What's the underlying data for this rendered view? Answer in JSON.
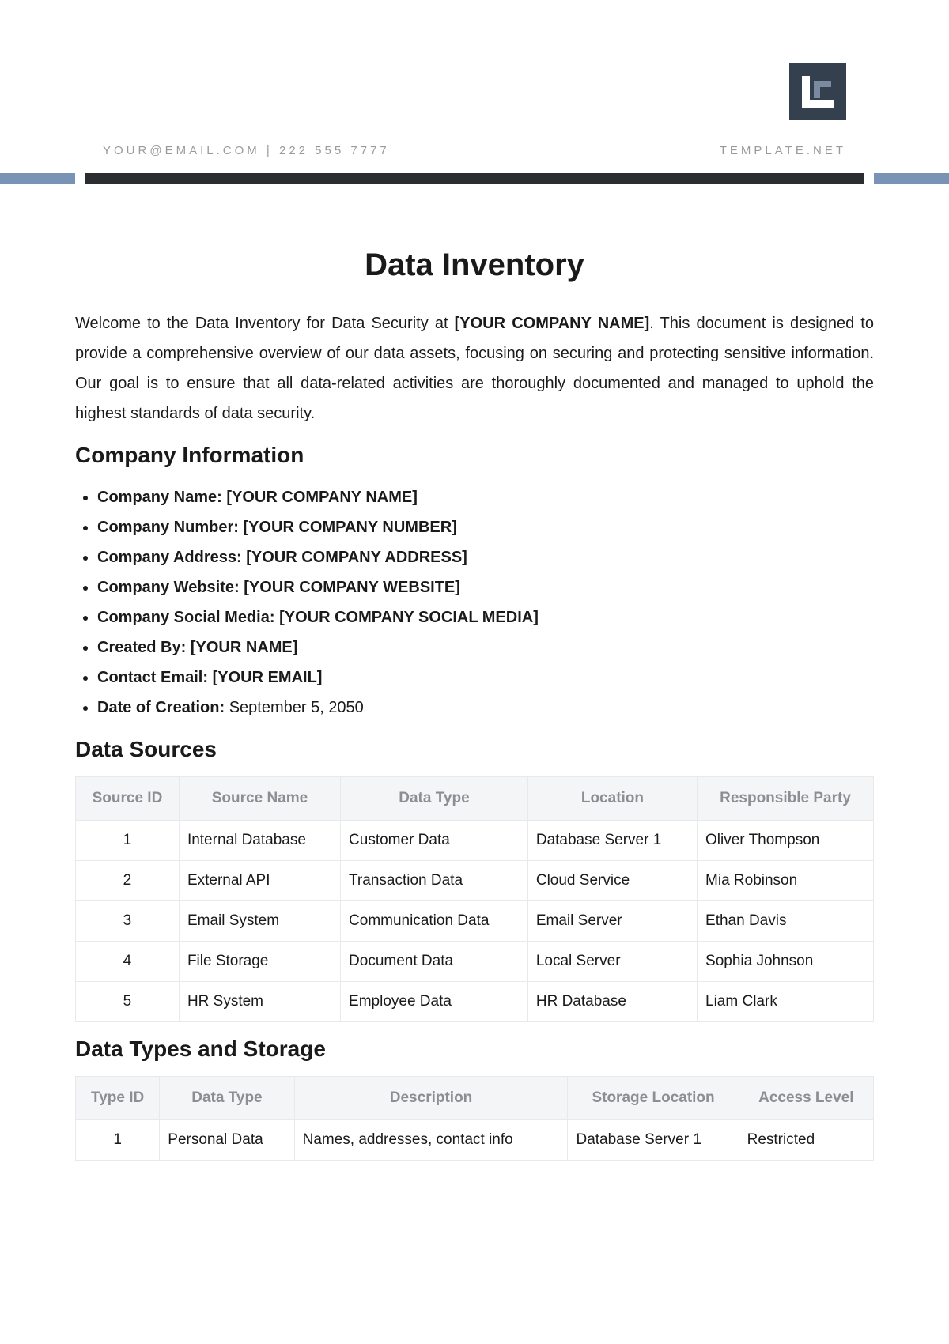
{
  "header": {
    "email": "YOUR@EMAIL.COM",
    "separator": " | ",
    "phone": "222 555 7777",
    "site": "TEMPLATE.NET"
  },
  "title": "Data Inventory",
  "intro": {
    "before": "Welcome to the Data Inventory for Data Security at ",
    "placeholder": "[YOUR COMPANY NAME]",
    "after": ". This document is designed to provide a comprehensive overview of our data assets, focusing on securing and protecting sensitive information. Our goal is to ensure that all data-related activities are thoroughly documented and managed to uphold the highest standards of data security."
  },
  "company_info_heading": "Company Information",
  "company_info": [
    {
      "label": "Company Name: ",
      "value": "[YOUR COMPANY NAME]"
    },
    {
      "label": "Company Number: ",
      "value": "[YOUR COMPANY NUMBER]"
    },
    {
      "label": "Company Address: ",
      "value": "[YOUR COMPANY ADDRESS]"
    },
    {
      "label": "Company Website: ",
      "value": "[YOUR COMPANY WEBSITE]"
    },
    {
      "label": "Company Social Media: ",
      "value": "[YOUR COMPANY SOCIAL MEDIA]"
    },
    {
      "label": "Created By: ",
      "value": "[YOUR NAME]"
    },
    {
      "label": "Contact Email: ",
      "value": "[YOUR EMAIL]"
    },
    {
      "label": "Date of Creation: ",
      "value": "September 5, 2050"
    }
  ],
  "data_sources_heading": "Data Sources",
  "data_sources": {
    "headers": [
      "Source ID",
      "Source Name",
      "Data Type",
      "Location",
      "Responsible Party"
    ],
    "rows": [
      [
        "1",
        "Internal Database",
        "Customer Data",
        "Database Server 1",
        "Oliver Thompson"
      ],
      [
        "2",
        "External API",
        "Transaction Data",
        "Cloud Service",
        "Mia Robinson"
      ],
      [
        "3",
        "Email System",
        "Communication Data",
        "Email Server",
        "Ethan Davis"
      ],
      [
        "4",
        "File Storage",
        "Document Data",
        "Local Server",
        "Sophia Johnson"
      ],
      [
        "5",
        "HR System",
        "Employee Data",
        "HR Database",
        "Liam Clark"
      ]
    ]
  },
  "data_types_heading": "Data Types and Storage",
  "data_types": {
    "headers": [
      "Type ID",
      "Data Type",
      "Description",
      "Storage Location",
      "Access Level"
    ],
    "rows": [
      [
        "1",
        "Personal Data",
        "Names, addresses, contact info",
        "Database Server 1",
        "Restricted"
      ]
    ]
  }
}
